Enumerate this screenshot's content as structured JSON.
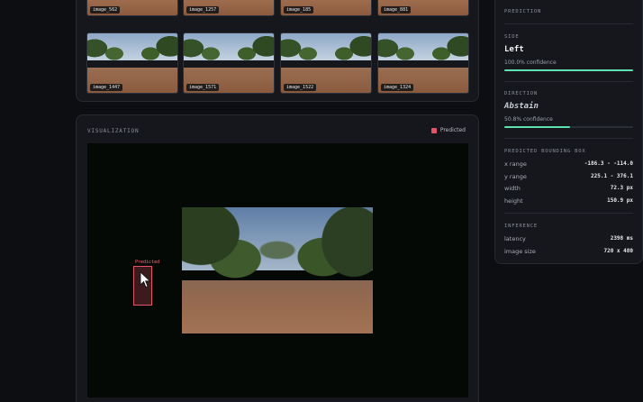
{
  "thumbnails": [
    {
      "label": "image_562"
    },
    {
      "label": "image_1257"
    },
    {
      "label": "image_185"
    },
    {
      "label": "image_881"
    },
    {
      "label": "image_1447"
    },
    {
      "label": "image_1571"
    },
    {
      "label": "image_1522"
    },
    {
      "label": "image_1324"
    }
  ],
  "visualization": {
    "title": "VISUALIZATION",
    "legend_label": "Predicted",
    "legend_color": "#e25468",
    "box_label": "Predicted"
  },
  "prediction": {
    "header": "PREDICTION",
    "side": {
      "label": "SIDE",
      "value": "Left",
      "confidence": "100.0% confidence",
      "confidence_fraction": 1.0
    },
    "direction": {
      "label": "DIRECTION",
      "value": "Abstain",
      "confidence": "50.8% confidence",
      "confidence_fraction": 0.508
    },
    "bbox": {
      "label": "PREDICTED BOUNDING BOX",
      "rows": [
        {
          "key": "x range",
          "value": "-186.3 - -114.0"
        },
        {
          "key": "y range",
          "value": "225.1 - 376.1"
        },
        {
          "key": "width",
          "value": "72.3 px"
        },
        {
          "key": "height",
          "value": "150.9 px"
        }
      ]
    },
    "inference": {
      "label": "INFERENCE",
      "rows": [
        {
          "key": "latency",
          "value": "2398 ms"
        },
        {
          "key": "image size",
          "value": "720 x 480"
        }
      ]
    }
  },
  "colors": {
    "accent": "#5fe0b0",
    "predicted": "#e25468"
  }
}
